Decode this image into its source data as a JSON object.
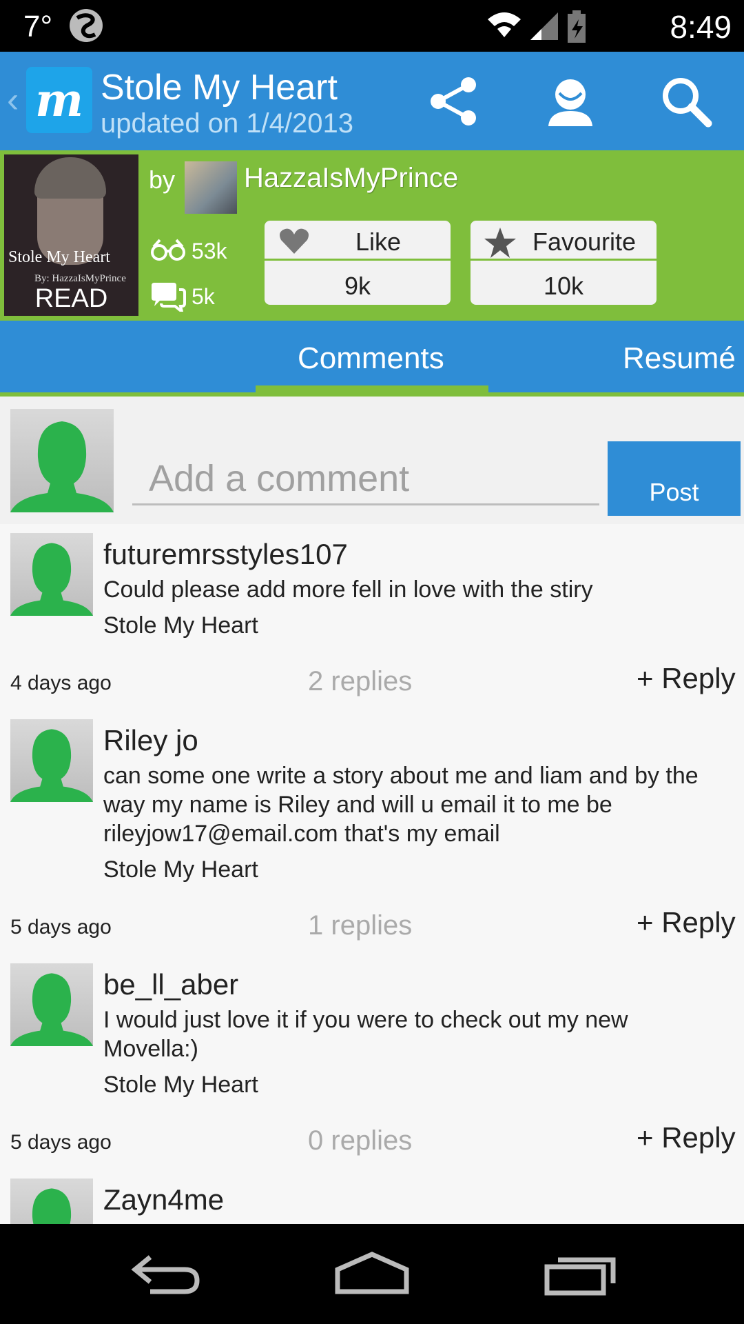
{
  "status_bar": {
    "temperature": "7°",
    "time": "8:49"
  },
  "app_bar": {
    "title": "Stole My Heart",
    "subtitle": "updated on 1/4/2013",
    "icons": [
      "back-icon",
      "movellas-logo",
      "share-icon",
      "profile-icon",
      "search-icon"
    ]
  },
  "story": {
    "cover": {
      "title": "Stole My Heart",
      "byline": "By: HazzaIsMyPrince",
      "read_label": "READ"
    },
    "by_label": "by",
    "author": "HazzaIsMyPrince",
    "reads": "53k",
    "comments": "5k",
    "like": {
      "label": "Like",
      "count": "9k"
    },
    "favourite": {
      "label": "Favourite",
      "count": "10k"
    }
  },
  "tabs": {
    "comments": "Comments",
    "resume": "Resumé"
  },
  "compose": {
    "placeholder": "Add a comment",
    "post_label": "Post"
  },
  "comments": [
    {
      "user": "futuremrsstyles107",
      "text": "Could please add more fell in love with the stiry",
      "story": "Stole My Heart",
      "age": "4 days ago",
      "replies_count": "2",
      "replies_label": "replies",
      "reply_label": "+ Reply"
    },
    {
      "user": "Riley jo",
      "text": "can some one write a story about me and liam and by the way my name is Riley and will u email it to me be rileyjow17@email.com that's my email",
      "story": "Stole My Heart",
      "age": "5 days ago",
      "replies_count": "1",
      "replies_label": "replies",
      "reply_label": "+ Reply"
    },
    {
      "user": "be_ll_aber",
      "text": "I would just love it if you were to check out my new Movella:)",
      "story": "Stole My Heart",
      "age": "5 days ago",
      "replies_count": "0",
      "replies_label": "replies",
      "reply_label": "+ Reply"
    },
    {
      "user": "Zayn4me"
    }
  ],
  "colors": {
    "primary_blue": "#2f8dd6",
    "accent_green": "#7fbe3c",
    "avatar_green": "#2bb24c"
  }
}
